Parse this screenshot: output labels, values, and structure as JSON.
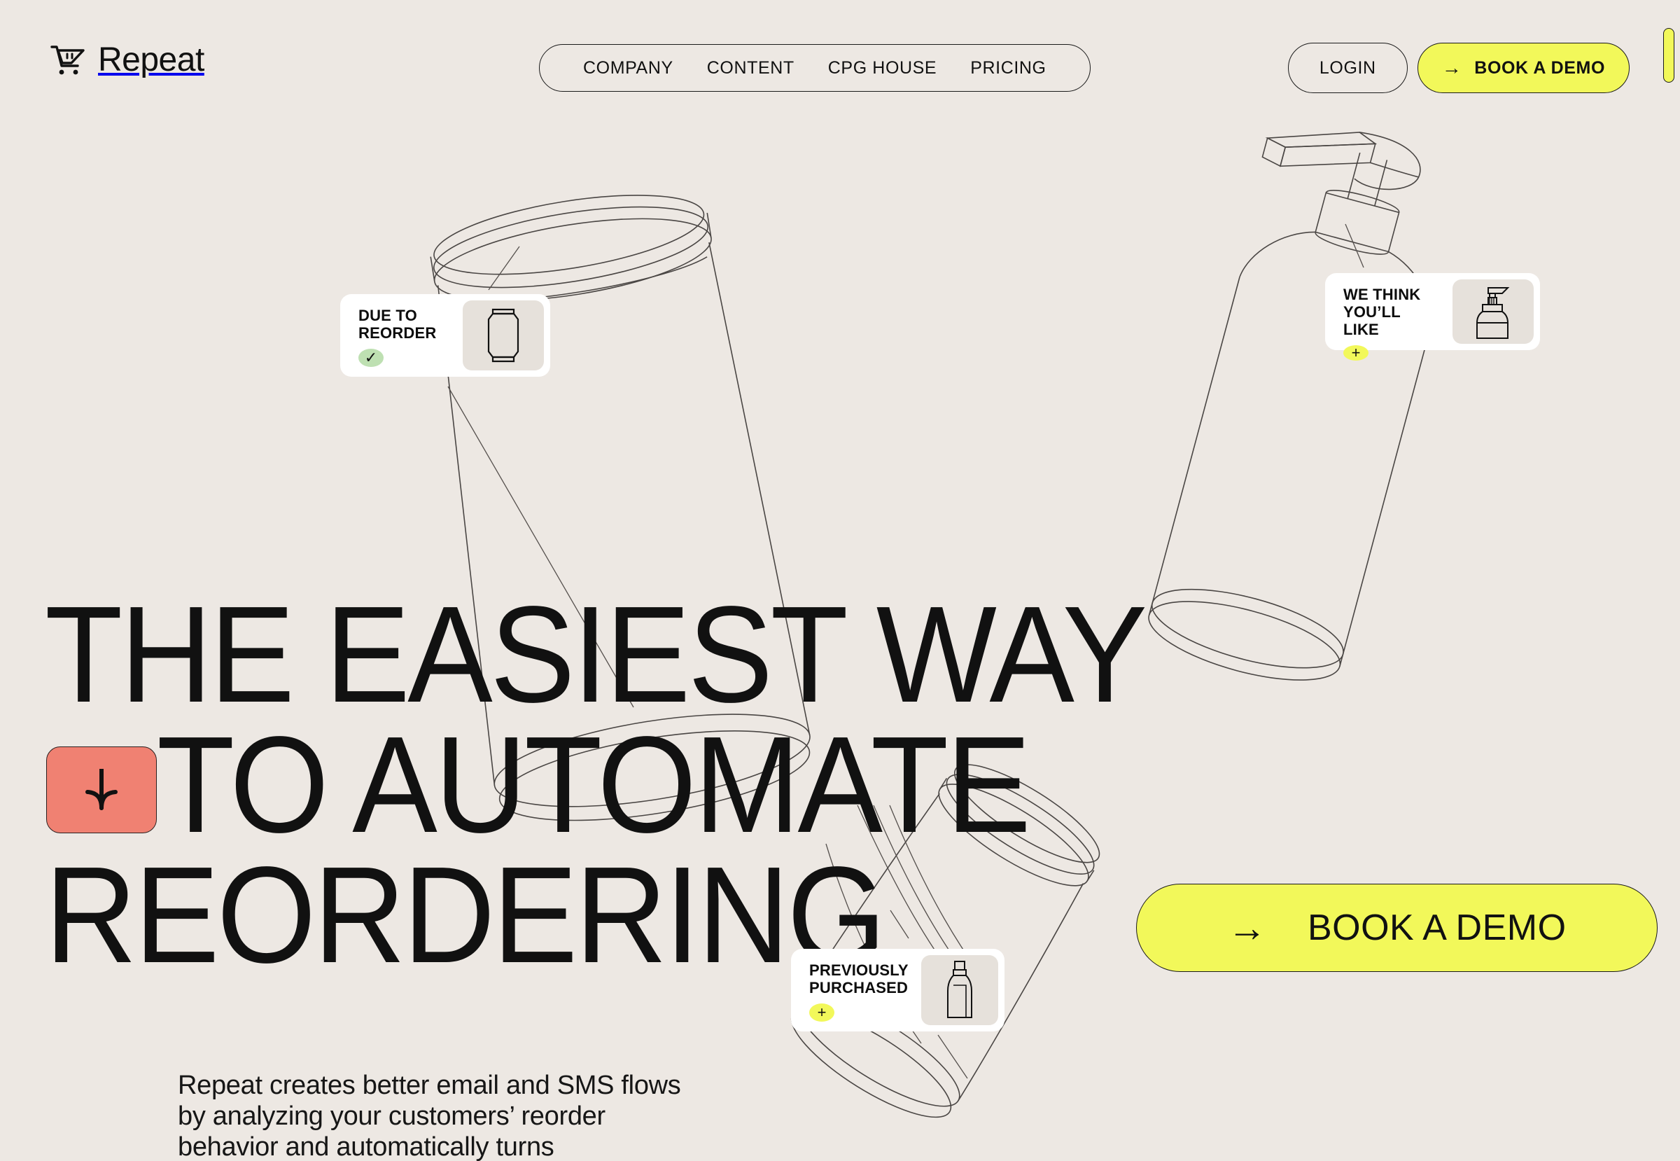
{
  "brand": {
    "name": "Repeat",
    "logo_icon": "shopping-cart-icon"
  },
  "nav": {
    "items": [
      {
        "label": "COMPANY"
      },
      {
        "label": "CONTENT"
      },
      {
        "label": "CPG HOUSE"
      },
      {
        "label": "PRICING"
      }
    ]
  },
  "header_actions": {
    "login_label": "LOGIN",
    "demo_label": "BOOK A DEMO",
    "demo_arrow": "→"
  },
  "hero": {
    "headline_lines": [
      "THE EASIEST WAY",
      "TO AUTOMATE",
      "REORDERING"
    ],
    "subtext": "Repeat creates better email and SMS flows by analyzing your customers’ reorder behavior and automatically turns",
    "cta_label": "BOOK A DEMO",
    "cta_arrow": "→",
    "scroll_cue_icon": "down-arrow-icon"
  },
  "cards": [
    {
      "id": "due",
      "title": "DUE TO\nREORDER",
      "badge": "✓",
      "badge_type": "check",
      "badge_color": "#BEE0B2",
      "thumb_icon": "soda-can-icon"
    },
    {
      "id": "wethink",
      "title": "WE THINK\nYOU’LL LIKE",
      "badge": "+",
      "badge_type": "plus",
      "badge_color": "#F2F85A",
      "thumb_icon": "pump-bottle-icon"
    },
    {
      "id": "prev",
      "title": "PREVIOUSLY\nPURCHASED",
      "badge": "+",
      "badge_type": "plus",
      "badge_color": "#F2F85A",
      "thumb_icon": "spray-bottle-icon"
    }
  ],
  "colors": {
    "background": "#EDE8E3",
    "accent_yellow": "#F2F85A",
    "accent_salmon": "#F08172",
    "accent_green": "#BEE0B2",
    "ink": "#111111"
  },
  "scrollbar": {
    "label": "page-scrollbar"
  }
}
